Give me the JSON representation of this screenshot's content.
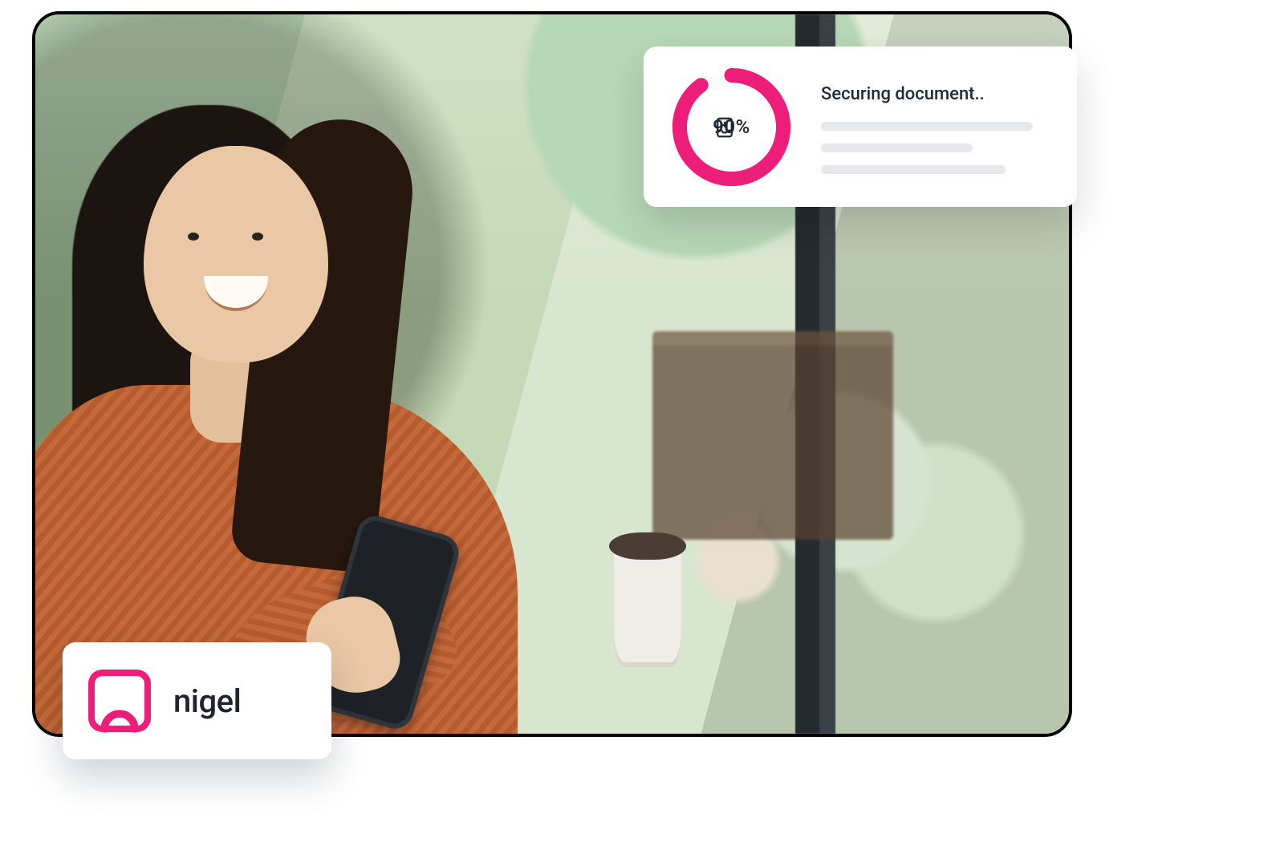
{
  "colors": {
    "accent": "#ed1e79",
    "text": "#1f2a37",
    "placeholder": "#e6e8eb",
    "sweater": "#c0612f"
  },
  "progress": {
    "title": "Securing document..",
    "percent_value": 90,
    "percent_label": "90%",
    "icon": "document-inbox-icon"
  },
  "brand": {
    "name": "nigel",
    "icon": "nigel-logo-icon"
  }
}
